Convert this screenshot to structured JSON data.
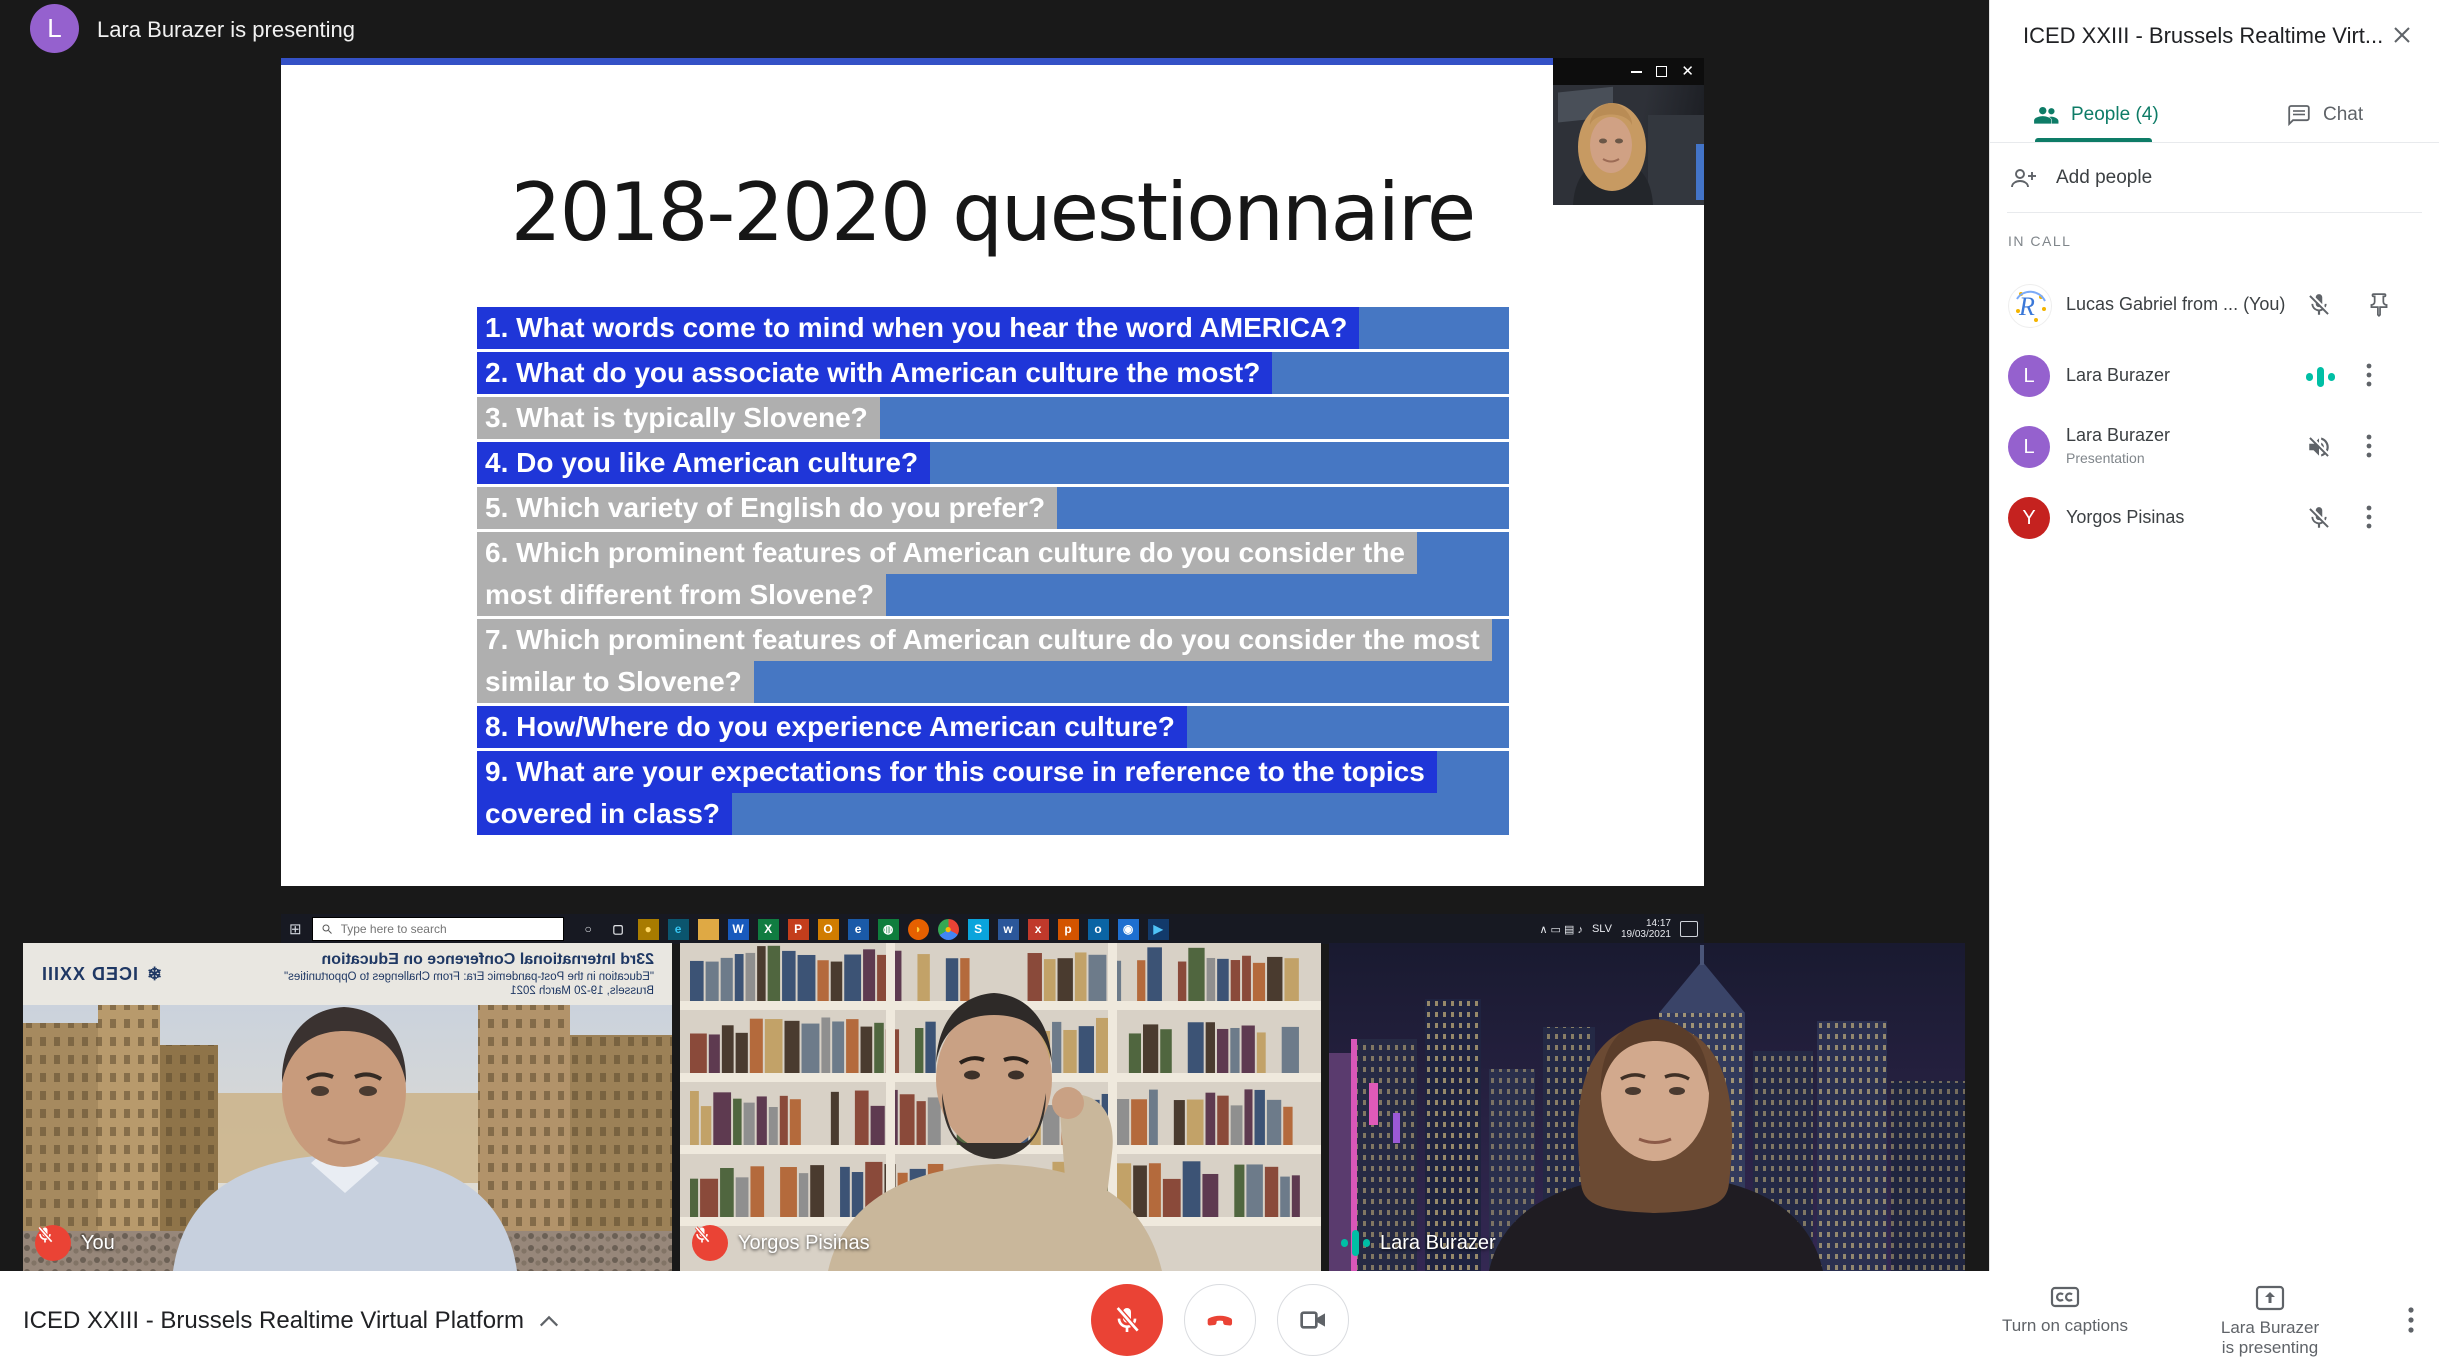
{
  "presenting_banner": {
    "avatar_initial": "L",
    "text": "Lara Burazer is presenting"
  },
  "slide": {
    "title": "2018-2020 questionnaire",
    "questions": [
      {
        "lines": [
          {
            "text": "1. What words come to mind when you hear the word AMERICA?",
            "hl": "blue"
          }
        ]
      },
      {
        "lines": [
          {
            "text": "2. What do you associate with American culture the most?",
            "hl": "blue"
          }
        ]
      },
      {
        "lines": [
          {
            "text": "3. What is typically Slovene?",
            "hl": "gray"
          }
        ]
      },
      {
        "lines": [
          {
            "text": "4. Do you like American culture?",
            "hl": "blue"
          }
        ]
      },
      {
        "lines": [
          {
            "text": "5. Which variety of English do you prefer?",
            "hl": "gray"
          }
        ]
      },
      {
        "lines": [
          {
            "text": "6. Which prominent features of American culture do you consider the",
            "hl": "gray"
          },
          {
            "text": "most different from Slovene?",
            "hl": "gray"
          }
        ]
      },
      {
        "lines": [
          {
            "text": "7. Which prominent features of American culture do you consider the most",
            "hl": "gray"
          },
          {
            "text": "similar to Slovene?",
            "hl": "gray"
          }
        ]
      },
      {
        "lines": [
          {
            "text": "8. How/Where do you experience American culture?",
            "hl": "blue"
          }
        ]
      },
      {
        "lines": [
          {
            "text": "9. What are your expectations for this course in reference to the topics",
            "hl": "blue"
          },
          {
            "text": "covered in class?",
            "hl": "blue"
          }
        ]
      }
    ]
  },
  "taskbar": {
    "search_placeholder": "Type here to search",
    "tray": {
      "glyphs": [
        "∧",
        "▭",
        "▤",
        "♪"
      ],
      "lang": "SLV",
      "time": "14:17",
      "date": "19/03/2021"
    },
    "icons": [
      {
        "bg": "transparent",
        "glyph": "○",
        "fg": "#dfe1e5",
        "round": true
      },
      {
        "bg": "transparent",
        "glyph": "▢",
        "fg": "#dfe1e5"
      },
      {
        "bg": "#a87b00",
        "glyph": "●",
        "fg": "#ffd866"
      },
      {
        "bg": "#0b556e",
        "glyph": "e",
        "fg": "#35c3f0"
      },
      {
        "bg": "#dfa944",
        "glyph": ""
      },
      {
        "bg": "#185ABD",
        "glyph": "W"
      },
      {
        "bg": "#107C41",
        "glyph": "X"
      },
      {
        "bg": "#C43E1C",
        "glyph": "P"
      },
      {
        "bg": "#d07c00",
        "glyph": "O"
      },
      {
        "bg": "#1a5aa8",
        "glyph": "e"
      },
      {
        "bg": "#0f7d3c",
        "glyph": "◍"
      },
      {
        "bg": "#e66000",
        "glyph": "◗",
        "fg": "#ffcc33",
        "round": true
      },
      {
        "bg": "conic-gradient(#EA4335 0 33%, #4285F4 33% 66%, #34A853 66% 100%)",
        "glyph": "●",
        "fg": "#FBBC05",
        "round": true
      },
      {
        "bg": "#0aa4dc",
        "glyph": "S"
      },
      {
        "bg": "#2b579a",
        "glyph": "w"
      },
      {
        "bg": "#c0392b",
        "glyph": "x"
      },
      {
        "bg": "#d35400",
        "glyph": "p"
      },
      {
        "bg": "#0a64a4",
        "glyph": "o"
      },
      {
        "bg": "#1e6fd0",
        "glyph": "◉"
      },
      {
        "bg": "#123a6b",
        "glyph": "▶",
        "fg": "#4fc3f7"
      }
    ]
  },
  "tiles": [
    {
      "name": "You",
      "muted": true
    },
    {
      "name": "Yorgos Pisinas",
      "muted": true
    },
    {
      "name": "Lara Burazer",
      "muted": false
    }
  ],
  "tile1_backdrop": {
    "line1": "23rd International Conference on Education",
    "line2": "\"Education in the Post-pandemic Era: From Challenges to Opportunities\"",
    "line3": "Brussels, 19-20 March 2021",
    "logo": "ICED XXIII"
  },
  "sidebar": {
    "title": "ICED XXIII - Brussels Realtime Virt...",
    "tabs": [
      {
        "label": "People (4)",
        "active": true
      },
      {
        "label": "Chat",
        "active": false
      }
    ],
    "add_people": "Add people",
    "section": "IN CALL",
    "participants": [
      {
        "name": "Lucas Gabriel from ... (You)",
        "avatar": "logo",
        "icons": [
          "mic-off",
          "pin"
        ]
      },
      {
        "name": "Lara Burazer",
        "avatar": "L",
        "avatar_color": "#9561CE",
        "icons": [
          "audio",
          "more"
        ]
      },
      {
        "name": "Lara Burazer",
        "subtitle": "Presentation",
        "avatar": "L",
        "avatar_color": "#9561CE",
        "icons": [
          "speaker-off",
          "more"
        ]
      },
      {
        "name": "Yorgos Pisinas",
        "avatar": "Y",
        "avatar_color": "#C5221F",
        "icons": [
          "mic-off",
          "more"
        ]
      }
    ]
  },
  "bottom_bar": {
    "meeting_name": "ICED XXIII - Brussels Realtime Virtual Platform",
    "captions_label": "Turn on captions",
    "presenting_line1": "Lara Burazer",
    "presenting_line2": "is presenting"
  },
  "colors": {
    "meet_red": "#EA4335",
    "tab_active_teal": "#0E7C67",
    "audio_teal": "#00BFA5",
    "avatar_purple": "#9561CE",
    "avatar_red": "#C5221F",
    "slide_row_blue": "#4677C3",
    "slide_highlight_blue": "#1F36D8",
    "slide_highlight_gray": "#AFAFAF"
  }
}
